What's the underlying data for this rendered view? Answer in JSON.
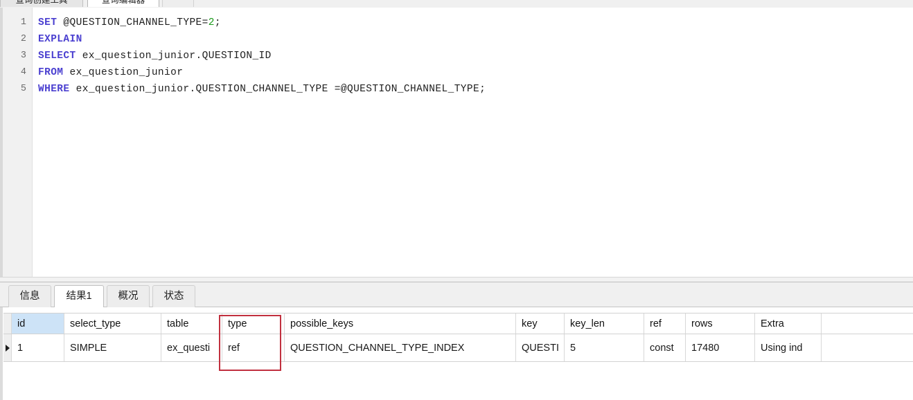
{
  "editor_tabs": [
    {
      "label": "查询创建工具",
      "active": false
    },
    {
      "label": "查询编辑器",
      "active": true
    },
    {
      "label": "",
      "active": false
    }
  ],
  "sql": {
    "line_numbers": [
      "1",
      "2",
      "3",
      "4",
      "5"
    ],
    "lines": [
      {
        "number": "1",
        "keyword": "SET",
        "rest": " @QUESTION_CHANNEL_TYPE=",
        "literal": "2",
        "tail": ";"
      },
      {
        "number": "2",
        "keyword": "EXPLAIN",
        "rest": "",
        "literal": "",
        "tail": ""
      },
      {
        "number": "3",
        "keyword": "SELECT",
        "rest": " ex_question_junior.QUESTION_ID",
        "literal": "",
        "tail": ""
      },
      {
        "number": "4",
        "keyword": "FROM",
        "rest": " ex_question_junior",
        "literal": "",
        "tail": ""
      },
      {
        "number": "5",
        "keyword": "WHERE",
        "rest": " ex_question_junior.QUESTION_CHANNEL_TYPE =@QUESTION_CHANNEL_TYPE",
        "literal": "",
        "tail": ";"
      }
    ]
  },
  "results_tabs": [
    {
      "label": "信息",
      "active": false
    },
    {
      "label": "结果1",
      "active": true
    },
    {
      "label": "概况",
      "active": false
    },
    {
      "label": "状态",
      "active": false
    }
  ],
  "results_table": {
    "columns": [
      "id",
      "select_type",
      "table",
      "type",
      "possible_keys",
      "key",
      "key_len",
      "ref",
      "rows",
      "Extra"
    ],
    "selected_column": "id",
    "rows": [
      {
        "marker": "▶",
        "id": "1",
        "select_type": "SIMPLE",
        "table": "ex_questi",
        "type": "ref",
        "possible_keys": "QUESTION_CHANNEL_TYPE_INDEX",
        "key": "QUESTI",
        "key_len": "5",
        "ref": "const",
        "rows": "17480",
        "Extra": "Using ind"
      }
    ]
  },
  "annotation": {
    "target_column": "type",
    "color": "#c1303f"
  }
}
